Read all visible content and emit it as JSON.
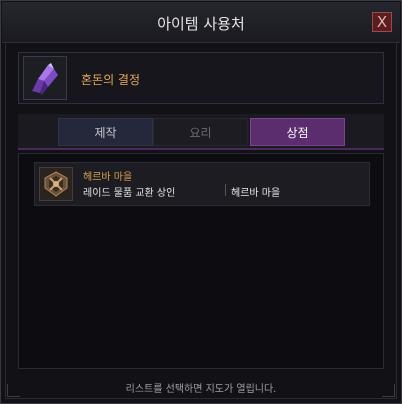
{
  "window": {
    "title": "아이템 사용처",
    "close_label": "X"
  },
  "item": {
    "name": "혼돈의 결정",
    "icon": "purple-crystal-icon"
  },
  "tabs": [
    {
      "label": "제작",
      "state": "normal"
    },
    {
      "label": "요리",
      "state": "disabled"
    },
    {
      "label": "상점",
      "state": "selected"
    }
  ],
  "list": {
    "rows": [
      {
        "location": "헤르바 마을",
        "npc": "레이드 물품 교환 상인",
        "zone": "헤르바 마을",
        "icon": "merchant-emblem-icon"
      }
    ]
  },
  "footer": {
    "hint": "리스트를 선택하면 지도가 열립니다."
  },
  "colors": {
    "accent_purple": "#5b2d6f",
    "item_name": "#e8a95a",
    "location_text": "#d8a050"
  }
}
